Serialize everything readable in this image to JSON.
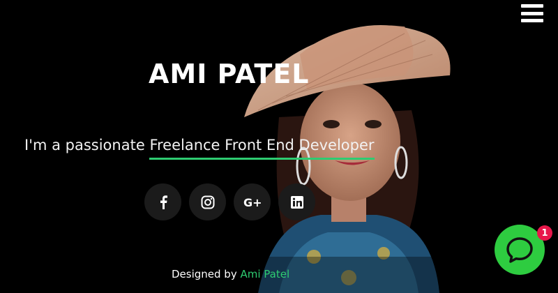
{
  "header": {
    "menu_icon": "hamburger-menu-icon"
  },
  "hero": {
    "name": "AMI PATEL",
    "tagline_prefix": "I'm a passionate",
    "tagline_role": "Freelance Front End Developer",
    "photo_alt": "Portrait of Ami Patel"
  },
  "social": [
    {
      "icon": "facebook-icon",
      "glyph": "f"
    },
    {
      "icon": "instagram-icon",
      "glyph": "instagram"
    },
    {
      "icon": "google-plus-icon",
      "glyph": "G+"
    },
    {
      "icon": "linkedin-icon",
      "glyph": "in"
    }
  ],
  "footer": {
    "prefix": "Designed by",
    "author": "Ami Patel"
  },
  "chat": {
    "icon": "chat-bubble-icon",
    "badge_count": "1"
  },
  "colors": {
    "accent": "#2ecc71",
    "chat_button": "#2ecc40",
    "badge": "#e8174a",
    "background": "#000000"
  }
}
